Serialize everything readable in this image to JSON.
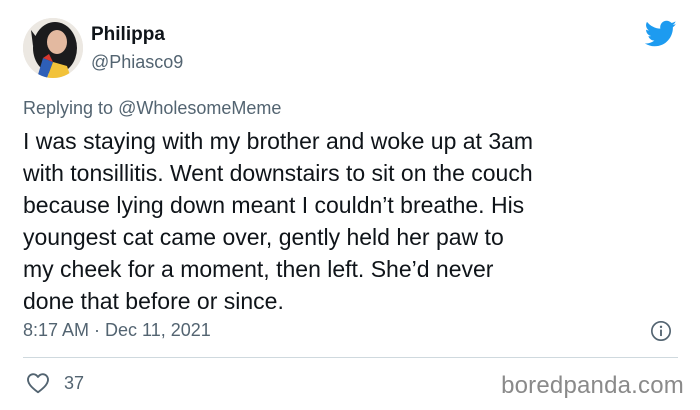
{
  "author": {
    "display_name": "Philippa",
    "handle": "@Phiasco9"
  },
  "reply": {
    "prefix": "Replying to",
    "mention": "@WholesomeMeme"
  },
  "tweet": {
    "text": "I was staying with my brother and woke up at 3am\nwith tonsillitis. Went downstairs to sit on the couch\nbecause lying down meant I couldn’t breathe. His\nyoungest cat came over, gently held her paw to\nmy cheek for a moment, then left. She’d never\ndone that before or since.",
    "timestamp": "8:17 AM · Dec 11, 2021"
  },
  "engagement": {
    "likes": "37"
  },
  "watermark": "boredpanda.com",
  "icons": {
    "brand": "twitter-bird-icon",
    "info": "info-icon",
    "like": "heart-icon"
  },
  "colors": {
    "twitter_blue": "#1d9bf0",
    "secondary_text": "#536471",
    "primary_text": "#0f1419",
    "divider": "#cfd9de"
  }
}
